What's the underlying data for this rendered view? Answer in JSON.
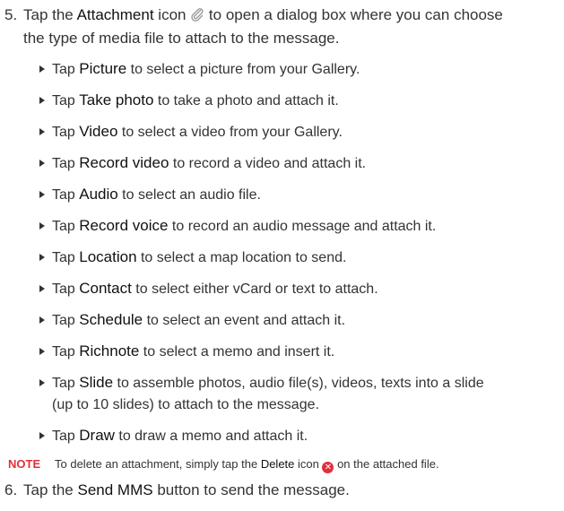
{
  "step5": {
    "number": "5.",
    "before": "Tap the ",
    "keyword": "Attachment",
    "after_icon_word": " icon ",
    "after": " to open a dialog box where you can choose",
    "line2": "the type of media file to attach to the message."
  },
  "icons": {
    "attachment": "paperclip-icon",
    "delete": "close-circle-icon",
    "bullet": "triangle-right-icon"
  },
  "bullets": [
    {
      "pre": "Tap ",
      "kw": "Picture",
      "post": " to select a picture from your Gallery."
    },
    {
      "pre": "Tap ",
      "kw": "Take photo",
      "post": " to take a photo and attach it."
    },
    {
      "pre": "Tap ",
      "kw": "Video",
      "post": " to select a video from your Gallery."
    },
    {
      "pre": "Tap ",
      "kw": "Record video",
      "post": " to record a video and attach it."
    },
    {
      "pre": "Tap ",
      "kw": "Audio",
      "post": " to select an audio file."
    },
    {
      "pre": "Tap ",
      "kw": "Record voice",
      "post": " to record an audio message and attach it."
    },
    {
      "pre": "Tap ",
      "kw": "Location",
      "post": " to select a map location to send."
    },
    {
      "pre": "Tap ",
      "kw": "Contact",
      "post": " to select either vCard or text to attach."
    },
    {
      "pre": "Tap ",
      "kw": "Schedule",
      "post": " to select an event and attach it."
    },
    {
      "pre": "Tap ",
      "kw": "Richnote",
      "post": " to select a memo and insert it."
    },
    {
      "pre": "Tap ",
      "kw": "Slide",
      "post": " to assemble photos, audio file(s), videos, texts into a slide",
      "line2": "(up to 10 slides) to attach to the message."
    },
    {
      "pre": "Tap ",
      "kw": "Draw",
      "post": " to draw a memo and attach it."
    }
  ],
  "note": {
    "label": "NOTE",
    "before": "To delete an attachment, simply tap the ",
    "keyword": "Delete",
    "middle": " icon ",
    "after": " on the attached file."
  },
  "step6": {
    "number": "6.",
    "before": "Tap the ",
    "keyword": "Send MMS",
    "after": " button to send the message."
  },
  "colors": {
    "text": "#333333",
    "note_accent": "#e0303a"
  }
}
